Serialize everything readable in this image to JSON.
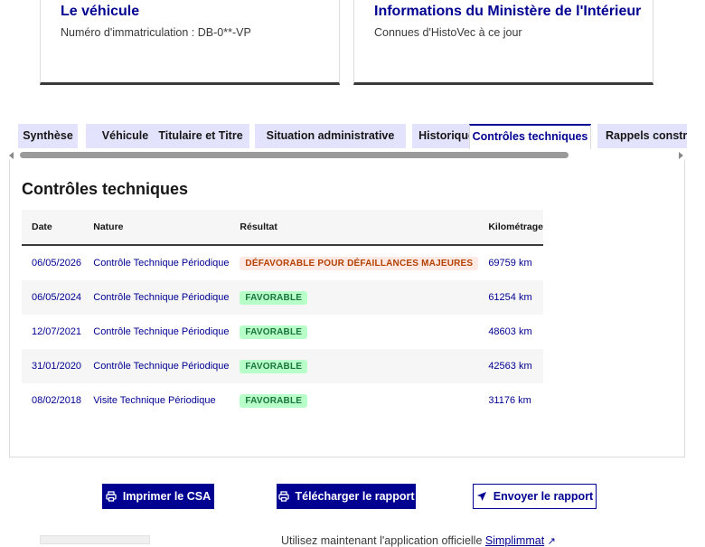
{
  "cards": {
    "vehicle": {
      "title": "Le véhicule",
      "subtitle": "Numéro d'immatriculation : DB-0**-VP"
    },
    "ministry": {
      "title": "Informations du Ministère de l'Intérieur",
      "subtitle": "Connues d'HistoVec à ce jour"
    }
  },
  "tabs": [
    {
      "label": "Synthèse"
    },
    {
      "label": "Véhicule"
    },
    {
      "label": "Titulaire et Titre"
    },
    {
      "label": "Situation administrative"
    },
    {
      "label": "Historique"
    },
    {
      "label": "Contrôles techniques",
      "active": true
    },
    {
      "label": "Rappels constructeur"
    }
  ],
  "section": {
    "title": "Contrôles techniques",
    "headers": {
      "date": "Date",
      "nature": "Nature",
      "result": "Résultat",
      "mileage": "Kilométrage"
    },
    "rows": [
      {
        "date": "06/05/2026",
        "nature": "Contrôle Technique Périodique",
        "result": "DÉFAVORABLE POUR DÉFAILLANCES MAJEURES",
        "status": "bad",
        "mileage": "69759 km"
      },
      {
        "date": "06/05/2024",
        "nature": "Contrôle Technique Périodique",
        "result": "FAVORABLE",
        "status": "good",
        "mileage": "61254 km"
      },
      {
        "date": "12/07/2021",
        "nature": "Contrôle Technique Périodique",
        "result": "FAVORABLE",
        "status": "good",
        "mileage": "48603 km"
      },
      {
        "date": "31/01/2020",
        "nature": "Contrôle Technique Périodique",
        "result": "FAVORABLE",
        "status": "good",
        "mileage": "42563 km"
      },
      {
        "date": "08/02/2018",
        "nature": "Visite Technique Périodique",
        "result": "FAVORABLE",
        "status": "good",
        "mileage": "31176 km"
      }
    ]
  },
  "actions": {
    "print": {
      "label": "Imprimer le CSA",
      "icon": "printer-icon"
    },
    "download": {
      "label": "Télécharger le rapport",
      "icon": "printer-icon"
    },
    "send": {
      "label": "Envoyer le rapport",
      "icon": "send-icon"
    }
  },
  "footer": {
    "text": "Utilisez maintenant l'application officielle ",
    "link": "Simplimmat"
  },
  "colors": {
    "brand": "#000091",
    "tab_bg": "#e3e3fd",
    "bad_bg": "#fee9e5",
    "bad_fg": "#b34000",
    "good_bg": "#b8fec9",
    "good_fg": "#18753c"
  }
}
